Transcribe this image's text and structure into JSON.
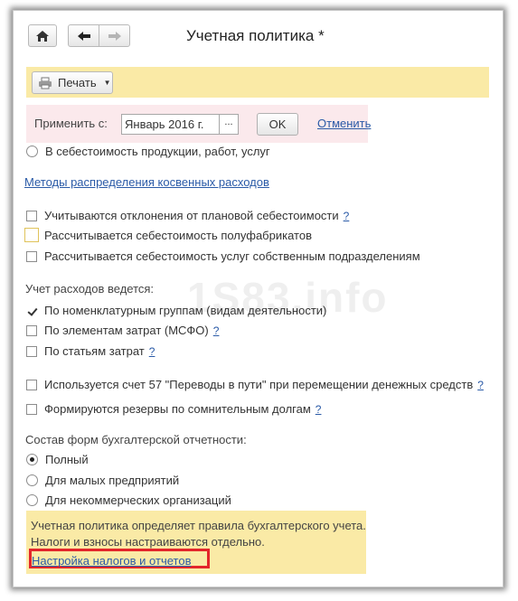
{
  "header": {
    "title": "Учетная политика *",
    "home_icon": "home-icon",
    "back_icon": "arrow-left-icon",
    "forward_icon": "arrow-right-icon"
  },
  "toolbar": {
    "print_label": "Печать",
    "print_icon": "printer-icon"
  },
  "apply": {
    "label": "Применить с:",
    "date_value": "Январь 2016 г.",
    "picker_label": "...",
    "ok_label": "OK",
    "cancel_label": "Отменить"
  },
  "content": {
    "partial_radio_text": "В себестоимость продукции, работ, услуг",
    "methods_link": "Методы распределения косвенных расходов",
    "cost_checks": [
      {
        "label": "Учитываются отклонения от плановой себестоимости",
        "checked": false,
        "help": "?"
      },
      {
        "label": "Рассчитывается себестоимость полуфабрикатов",
        "checked": false
      },
      {
        "label": "Рассчитывается себестоимость услуг собственным подразделениям",
        "checked": false
      }
    ],
    "expenses_label": "Учет расходов ведется:",
    "expense_checks": [
      {
        "label": "По номенклатурным группам (видам деятельности)",
        "checked": true
      },
      {
        "label": "По элементам затрат (МСФО)",
        "checked": false,
        "help": "?"
      },
      {
        "label": "По статьям затрат",
        "checked": false,
        "help": "?"
      }
    ],
    "account57": {
      "label": "Используется счет 57 \"Переводы в пути\" при перемещении денежных средств",
      "help": "?"
    },
    "reserves": {
      "label": "Формируются резервы по сомнительным долгам",
      "help": "?"
    },
    "forms_label": "Состав форм бухгалтерской отчетности:",
    "forms_options": [
      {
        "label": "Полный",
        "selected": true
      },
      {
        "label": "Для малых предприятий",
        "selected": false
      },
      {
        "label": "Для некоммерческих организаций",
        "selected": false
      }
    ],
    "watermark": "1S83.info"
  },
  "info": {
    "line1": "Учетная политика определяет правила бухгалтерского учета.",
    "line2": "Налоги и взносы настраиваются отдельно.",
    "link": "Настройка налогов и отчетов"
  },
  "colors": {
    "accent_link": "#2a5aa7",
    "yellow_panel": "#faeaa6",
    "pink_panel": "#fbe9ec",
    "highlight_frame": "#e3262b"
  }
}
